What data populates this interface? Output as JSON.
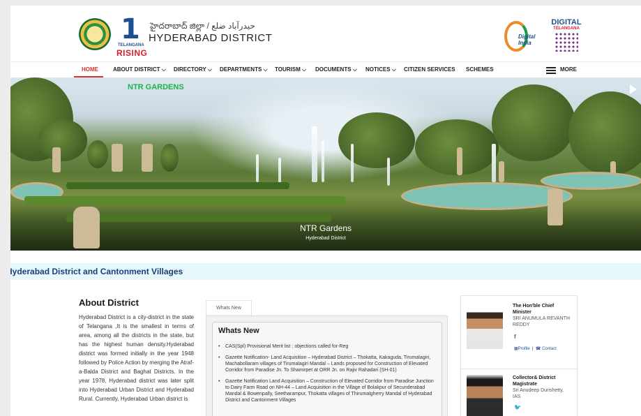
{
  "header": {
    "telugu_district": "హైదరాబాద్ జిల్లా / ﺣﯿﺪﺭﺁﺑﺎﺩ ﺿﻠﻊ",
    "district_name": "HYDERABAD DISTRICT",
    "rising_one": "1",
    "rising_telangana": "TELANGANA",
    "rising_word": "RISING",
    "digital_india_text": "Digital India",
    "digital_telangana_1": "DIGITAL",
    "digital_telangana_2": "TELANGANA"
  },
  "nav": {
    "items": [
      {
        "label": "HOME"
      },
      {
        "label": "ABOUT DISTRICT ⌵"
      },
      {
        "label": "DIRECTORY ⌵"
      },
      {
        "label": "DEPARTMENTS ⌵"
      },
      {
        "label": "TOURISM ⌵"
      },
      {
        "label": "DOCUMENTS ⌵"
      },
      {
        "label": "NOTICES ⌵"
      },
      {
        "label": "CITIZEN SERVICES"
      },
      {
        "label": "SCHEMES"
      },
      {
        "label": "MORE"
      }
    ]
  },
  "hero": {
    "top_label": "NTR GARDENS",
    "caption_title": "NTR Gardens",
    "caption_sub": "Hyderabad District"
  },
  "strip": {
    "text": "Hyderabad District and Cantonment Villages"
  },
  "about": {
    "title": "About District",
    "text": "Hyderabad District is a city-district in the state of Telangana ,It is the smallest in terms of area, among all the districts in the state, but has the highest human density.Hyderabad district was formed initially in the year 1948 followed by Police Action by merging the Atraf-a-Balda District and Baghat Districts. In the year 1978, Hyderabad district was later split into Hyderabad Urban District and Hyderabad Rural. Currently, Hyderabad Urban district is"
  },
  "whats_new": {
    "tab_label": "Whats New",
    "title": "Whats New",
    "items": [
      "CAS(Spl) Provisional Merit list ; objections called for-Reg",
      "Gazette Notification- Land Acquisition – Hyderabad District – Thokatta, Kakaguda, Tirumalagiri, Machabollaram villages of Tirumalagiri Mandal – Lands proposed for Construction of Elevated Corridor from Paradise Jn. To Shamirpet at ORR Jn. on Rajiv Rahadari (SH-01)",
      "Gazette Notification Land Acquisition – Construction of Elevated Corridor from Paradise Junction to Dairy Farm Road on NH-44 – Land Acquisition in the Village of Bolakpur of Secunderabad Mandal & Bowenpally, Seetharampur, Thokatta villages of Thirumalgherry Mandal of Hyderabad District and Cantonment Villages"
    ]
  },
  "officials": [
    {
      "title": "The Hon'ble Chief Minister",
      "name": "SRI ANUMULA REVANTH REDDY",
      "social": "f",
      "profile": "Profile",
      "contact": "Contact"
    },
    {
      "title": "Collector& District Magistrate",
      "name": "Sri Anudeep Durishetty, IAS",
      "social": "t"
    }
  ]
}
